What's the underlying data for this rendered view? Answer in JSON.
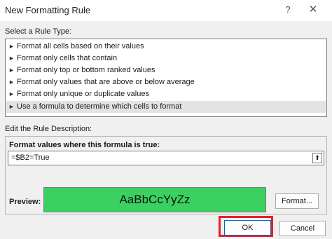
{
  "window": {
    "title": "New Formatting Rule",
    "help_glyph": "?",
    "close_glyph": "✕"
  },
  "rule_type": {
    "label": "Select a Rule Type:",
    "items": [
      {
        "label": "Format all cells based on their values"
      },
      {
        "label": "Format only cells that contain"
      },
      {
        "label": "Format only top or bottom ranked values"
      },
      {
        "label": "Format only values that are above or below average"
      },
      {
        "label": "Format only unique or duplicate values"
      },
      {
        "label": "Use a formula to determine which cells to format",
        "selected": true
      }
    ],
    "item_icon": "►"
  },
  "description": {
    "label": "Edit the Rule Description:",
    "formula_label": "Format values where this formula is true:",
    "formula_value": "=$B2=True",
    "collapse_icon": "⬆"
  },
  "preview": {
    "label": "Preview:",
    "sample_text": "AaBbCcYyZz",
    "fill_color": "#3bd160"
  },
  "buttons": {
    "format": "Format...",
    "ok": "OK",
    "cancel": "Cancel"
  }
}
